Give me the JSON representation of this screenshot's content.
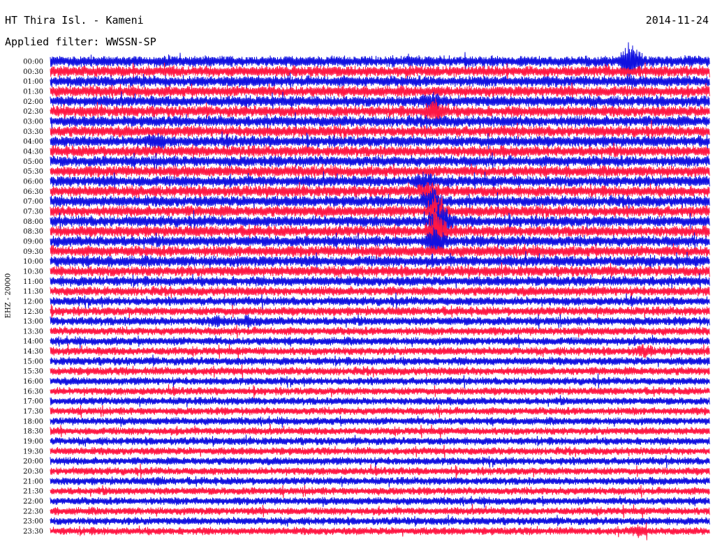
{
  "header": {
    "station": "HT Thira Isl. - Kameni",
    "date": "2014-11-24",
    "filter": "Applied filter: WWSSN-SP"
  },
  "chart_data": {
    "type": "line",
    "title": "HT Thira Isl. - Kameni",
    "ylabel": "EHZ - 20000",
    "row_labels": [
      "00:00",
      "00:30",
      "01:00",
      "01:30",
      "02:00",
      "02:30",
      "03:00",
      "03:30",
      "04:00",
      "04:30",
      "05:00",
      "05:30",
      "06:00",
      "06:30",
      "07:00",
      "07:30",
      "08:00",
      "08:30",
      "09:00",
      "09:30",
      "10:00",
      "10:30",
      "11:00",
      "11:30",
      "12:00",
      "12:30",
      "13:00",
      "13:30",
      "14:00",
      "14:30",
      "15:00",
      "15:30",
      "16:00",
      "16:30",
      "17:00",
      "17:30",
      "18:00",
      "18:30",
      "19:00",
      "19:30",
      "20:00",
      "20:30",
      "21:00",
      "21:30",
      "22:00",
      "22:30",
      "23:00",
      "23:30"
    ],
    "series_colors": [
      "#1010e0",
      "#ff1744"
    ],
    "background": "#ffffff",
    "row_amplitude": [
      1.0,
      1.0,
      1.0,
      1.0,
      1.0,
      1.0,
      1.0,
      1.0,
      1.0,
      1.0,
      1.0,
      1.0,
      1.0,
      1.0,
      1.0,
      1.0,
      1.0,
      1.0,
      1.0,
      1.0,
      1.0,
      0.95,
      0.9,
      0.85,
      0.8,
      0.8,
      0.8,
      0.75,
      0.75,
      0.75,
      0.75,
      0.75,
      0.7,
      0.7,
      0.7,
      0.7,
      0.7,
      0.7,
      0.7,
      0.7,
      0.7,
      0.7,
      0.7,
      0.7,
      0.7,
      0.7,
      0.7,
      0.7
    ],
    "events": [
      {
        "row": 0,
        "minute": 26.4,
        "amplitude": 4.0
      },
      {
        "row": 4,
        "minute": 17.3,
        "amplitude": 2.2
      },
      {
        "row": 5,
        "minute": 17.5,
        "amplitude": 2.6
      },
      {
        "row": 8,
        "minute": 4.8,
        "amplitude": 1.8
      },
      {
        "row": 12,
        "minute": 17.0,
        "amplitude": 2.0
      },
      {
        "row": 13,
        "minute": 17.2,
        "amplitude": 2.4
      },
      {
        "row": 14,
        "minute": 17.4,
        "amplitude": 3.0
      },
      {
        "row": 15,
        "minute": 17.6,
        "amplitude": 3.4
      },
      {
        "row": 16,
        "minute": 17.8,
        "amplitude": 3.6
      },
      {
        "row": 17,
        "minute": 17.6,
        "amplitude": 4.0
      },
      {
        "row": 18,
        "minute": 17.5,
        "amplitude": 3.0
      },
      {
        "row": 26,
        "minute": 7.5,
        "amplitude": 1.6
      },
      {
        "row": 26,
        "minute": 9.0,
        "amplitude": 1.4
      },
      {
        "row": 29,
        "minute": 27.0,
        "amplitude": 1.8
      },
      {
        "row": 42,
        "minute": 5.0,
        "amplitude": 1.3
      },
      {
        "row": 47,
        "minute": 26.8,
        "amplitude": 1.8
      }
    ]
  }
}
